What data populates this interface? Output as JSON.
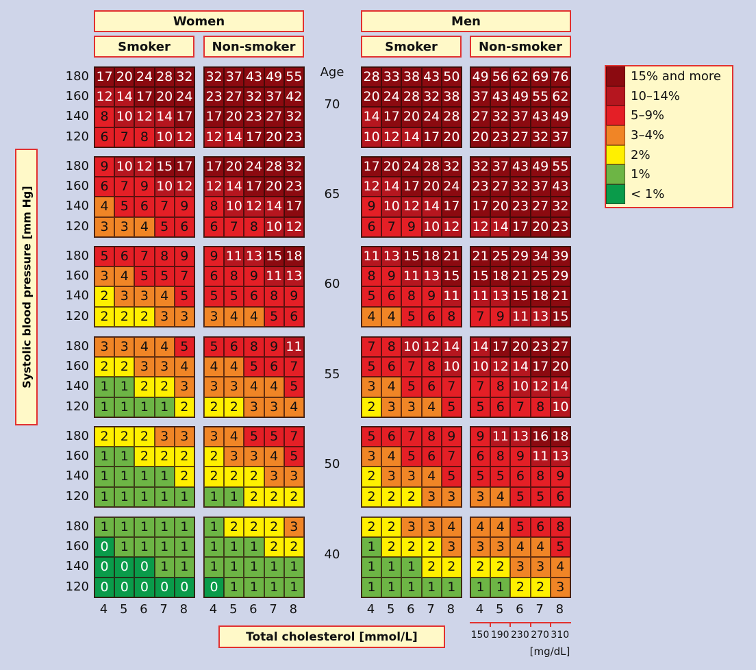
{
  "headers": {
    "women": "Women",
    "men": "Men",
    "smoker": "Smoker",
    "non_smoker": "Non-smoker",
    "age": "Age"
  },
  "y_axis_label": "Systolic blood pressure [mm Hg]",
  "x_axis_label": "Total cholesterol [mmol/L]",
  "sbp_levels": [
    "180",
    "160",
    "140",
    "120"
  ],
  "cholesterol_mmol": [
    "4",
    "5",
    "6",
    "7",
    "8"
  ],
  "cholesterol_mgdl": [
    "150",
    "190",
    "230",
    "270",
    "310"
  ],
  "mgdl_unit": "[mg/dL]",
  "legend": [
    {
      "label": "15% and more",
      "color": "#8b0a10",
      "min": 15
    },
    {
      "label": "10–14%",
      "color": "#b5161f",
      "min": 10
    },
    {
      "label": "5–9%",
      "color": "#e41f26",
      "min": 5
    },
    {
      "label": "3–4%",
      "color": "#f08526",
      "min": 3
    },
    {
      "label": "2%",
      "color": "#fff000",
      "min": 2
    },
    {
      "label": "1%",
      "color": "#6db545",
      "min": 1
    },
    {
      "label": "< 1%",
      "color": "#0a9b4a",
      "min": 0
    }
  ],
  "chart_data": {
    "type": "heatmap",
    "title": "",
    "xlabel": "Total cholesterol [mmol/L]",
    "ylabel": "Systolic blood pressure [mm Hg]",
    "x": [
      4,
      5,
      6,
      7,
      8
    ],
    "y": [
      180,
      160,
      140,
      120
    ],
    "panels": [
      {
        "age": "70",
        "women_smoker": [
          [
            17,
            20,
            24,
            28,
            32
          ],
          [
            12,
            14,
            17,
            20,
            24
          ],
          [
            8,
            10,
            12,
            14,
            17
          ],
          [
            6,
            7,
            8,
            10,
            12
          ]
        ],
        "women_non_smoker": [
          [
            32,
            37,
            43,
            49,
            55
          ],
          [
            23,
            27,
            32,
            37,
            42
          ],
          [
            17,
            20,
            23,
            27,
            32
          ],
          [
            12,
            14,
            17,
            20,
            23
          ]
        ],
        "men_smoker": [
          [
            28,
            33,
            38,
            43,
            50
          ],
          [
            20,
            24,
            28,
            32,
            38
          ],
          [
            14,
            17,
            20,
            24,
            28
          ],
          [
            10,
            12,
            14,
            17,
            20
          ]
        ],
        "men_non_smoker": [
          [
            49,
            56,
            62,
            69,
            76
          ],
          [
            37,
            43,
            49,
            55,
            62
          ],
          [
            27,
            32,
            37,
            43,
            49
          ],
          [
            20,
            23,
            27,
            32,
            37
          ]
        ]
      },
      {
        "age": "65",
        "women_smoker": [
          [
            9,
            10,
            12,
            15,
            17
          ],
          [
            6,
            7,
            9,
            10,
            12
          ],
          [
            4,
            5,
            6,
            7,
            9
          ],
          [
            3,
            3,
            4,
            5,
            6
          ]
        ],
        "women_non_smoker": [
          [
            17,
            20,
            24,
            28,
            32
          ],
          [
            12,
            14,
            17,
            20,
            23
          ],
          [
            8,
            10,
            12,
            14,
            17
          ],
          [
            6,
            7,
            8,
            10,
            12
          ]
        ],
        "men_smoker": [
          [
            17,
            20,
            24,
            28,
            32
          ],
          [
            12,
            14,
            17,
            20,
            24
          ],
          [
            9,
            10,
            12,
            14,
            17
          ],
          [
            6,
            7,
            9,
            10,
            12
          ]
        ],
        "men_non_smoker": [
          [
            32,
            37,
            43,
            49,
            55
          ],
          [
            23,
            27,
            32,
            37,
            43
          ],
          [
            17,
            20,
            23,
            27,
            32
          ],
          [
            12,
            14,
            17,
            20,
            23
          ]
        ]
      },
      {
        "age": "60",
        "women_smoker": [
          [
            5,
            6,
            7,
            8,
            9
          ],
          [
            3,
            4,
            5,
            5,
            7
          ],
          [
            2,
            3,
            3,
            4,
            5
          ],
          [
            2,
            2,
            2,
            3,
            3
          ]
        ],
        "women_non_smoker": [
          [
            9,
            11,
            13,
            15,
            18
          ],
          [
            6,
            8,
            9,
            11,
            13
          ],
          [
            5,
            5,
            6,
            8,
            9
          ],
          [
            3,
            4,
            4,
            5,
            6
          ]
        ],
        "men_smoker": [
          [
            11,
            13,
            15,
            18,
            21
          ],
          [
            8,
            9,
            11,
            13,
            15
          ],
          [
            5,
            6,
            8,
            9,
            11
          ],
          [
            4,
            4,
            5,
            6,
            8
          ]
        ],
        "men_non_smoker": [
          [
            21,
            25,
            29,
            34,
            39
          ],
          [
            15,
            18,
            21,
            25,
            29
          ],
          [
            11,
            13,
            15,
            18,
            21
          ],
          [
            7,
            9,
            11,
            13,
            15
          ]
        ]
      },
      {
        "age": "55",
        "women_smoker": [
          [
            3,
            3,
            4,
            4,
            5
          ],
          [
            2,
            2,
            3,
            3,
            4
          ],
          [
            1,
            1,
            2,
            2,
            3
          ],
          [
            1,
            1,
            1,
            1,
            2
          ]
        ],
        "women_non_smoker": [
          [
            5,
            6,
            8,
            9,
            11
          ],
          [
            4,
            4,
            5,
            6,
            7
          ],
          [
            3,
            3,
            4,
            4,
            5
          ],
          [
            2,
            2,
            3,
            3,
            4
          ]
        ],
        "men_smoker": [
          [
            7,
            8,
            10,
            12,
            14
          ],
          [
            5,
            6,
            7,
            8,
            10
          ],
          [
            3,
            4,
            5,
            6,
            7
          ],
          [
            2,
            3,
            3,
            4,
            5
          ]
        ],
        "men_non_smoker": [
          [
            14,
            17,
            20,
            23,
            27
          ],
          [
            10,
            12,
            14,
            17,
            20
          ],
          [
            7,
            8,
            10,
            12,
            14
          ],
          [
            5,
            6,
            7,
            8,
            10
          ]
        ]
      },
      {
        "age": "50",
        "women_smoker": [
          [
            2,
            2,
            2,
            3,
            3
          ],
          [
            1,
            1,
            2,
            2,
            2
          ],
          [
            1,
            1,
            1,
            1,
            2
          ],
          [
            1,
            1,
            1,
            1,
            1
          ]
        ],
        "women_non_smoker": [
          [
            3,
            4,
            5,
            5,
            7
          ],
          [
            2,
            3,
            3,
            4,
            5
          ],
          [
            2,
            2,
            2,
            3,
            3
          ],
          [
            1,
            1,
            2,
            2,
            2
          ]
        ],
        "men_smoker": [
          [
            5,
            6,
            7,
            8,
            9
          ],
          [
            3,
            4,
            5,
            6,
            7
          ],
          [
            2,
            3,
            3,
            4,
            5
          ],
          [
            2,
            2,
            2,
            3,
            3
          ]
        ],
        "men_non_smoker": [
          [
            9,
            11,
            13,
            16,
            18
          ],
          [
            6,
            8,
            9,
            11,
            13
          ],
          [
            5,
            5,
            6,
            8,
            9
          ],
          [
            3,
            4,
            5,
            5,
            6
          ]
        ]
      },
      {
        "age": "40",
        "women_smoker": [
          [
            1,
            1,
            1,
            1,
            1
          ],
          [
            0,
            1,
            1,
            1,
            1
          ],
          [
            0,
            0,
            0,
            1,
            1
          ],
          [
            0,
            0,
            0,
            0,
            0
          ]
        ],
        "women_non_smoker": [
          [
            1,
            2,
            2,
            2,
            3
          ],
          [
            1,
            1,
            1,
            2,
            2
          ],
          [
            1,
            1,
            1,
            1,
            1
          ],
          [
            0,
            1,
            1,
            1,
            1
          ]
        ],
        "men_smoker": [
          [
            2,
            2,
            3,
            3,
            4
          ],
          [
            1,
            2,
            2,
            2,
            3
          ],
          [
            1,
            1,
            1,
            2,
            2
          ],
          [
            1,
            1,
            1,
            1,
            1
          ]
        ],
        "men_non_smoker": [
          [
            4,
            4,
            5,
            6,
            8
          ],
          [
            3,
            3,
            4,
            4,
            5
          ],
          [
            2,
            2,
            3,
            3,
            4
          ],
          [
            1,
            1,
            2,
            2,
            3
          ]
        ]
      }
    ]
  }
}
